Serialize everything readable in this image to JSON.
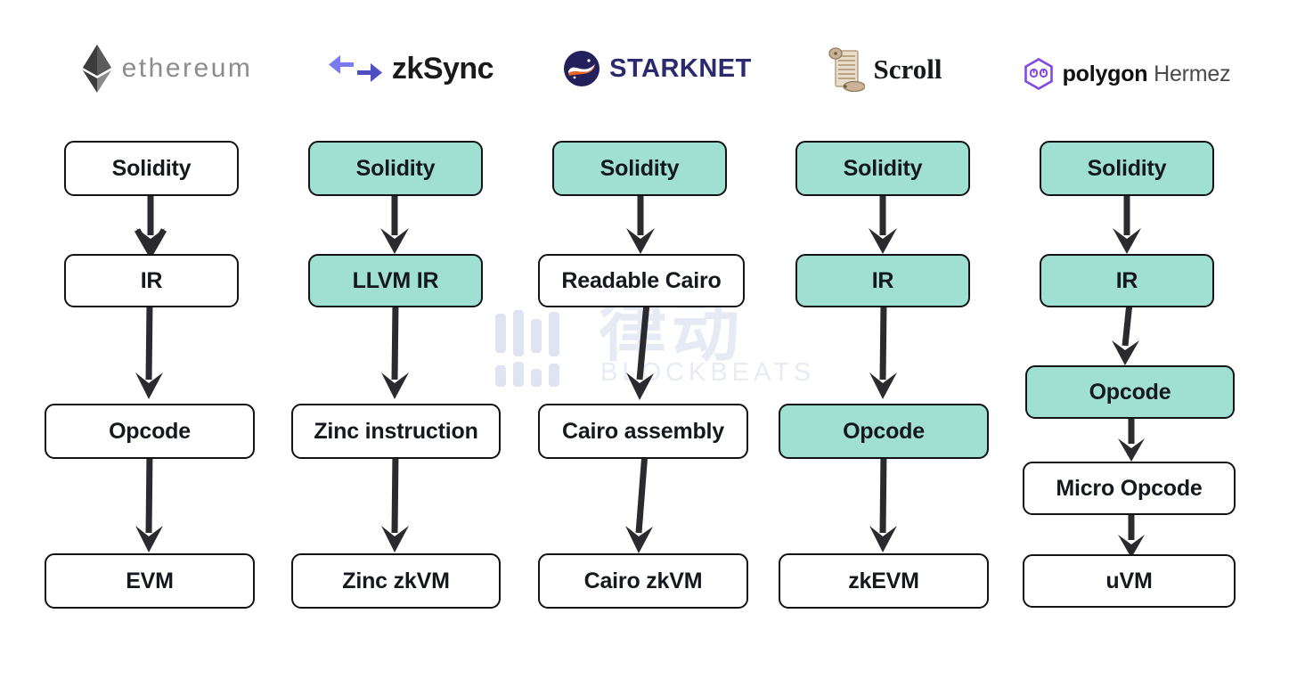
{
  "diagram": {
    "title": "zkEVM compilation pipelines",
    "accent_mint": "#9fe0d2",
    "stroke": "#111316",
    "background": "#ffffff"
  },
  "watermark": {
    "han": "律动",
    "word": "BLOCKBEATS",
    "color": "#e3e7f3"
  },
  "columns": [
    {
      "id": "ethereum",
      "logo_name": "ethereum-logo",
      "logo_text": "ethereum",
      "nodes": [
        {
          "label": "Solidity",
          "highlight": false
        },
        {
          "label": "IR",
          "highlight": false
        },
        {
          "label": "Opcode",
          "highlight": false
        },
        {
          "label": "EVM",
          "highlight": false
        }
      ]
    },
    {
      "id": "zksync",
      "logo_name": "zksync-logo",
      "logo_text": "zkSync",
      "nodes": [
        {
          "label": "Solidity",
          "highlight": true
        },
        {
          "label": "LLVM IR",
          "highlight": true
        },
        {
          "label": "Zinc instruction",
          "highlight": false
        },
        {
          "label": "Zinc zkVM",
          "highlight": false
        }
      ]
    },
    {
      "id": "starknet",
      "logo_name": "starknet-logo",
      "logo_text_1": "STARK",
      "logo_text_2": "NET",
      "nodes": [
        {
          "label": "Solidity",
          "highlight": true
        },
        {
          "label": "Readable Cairo",
          "highlight": false
        },
        {
          "label": "Cairo assembly",
          "highlight": false
        },
        {
          "label": "Cairo zkVM",
          "highlight": false
        }
      ]
    },
    {
      "id": "scroll",
      "logo_name": "scroll-logo",
      "logo_text": "Scroll",
      "nodes": [
        {
          "label": "Solidity",
          "highlight": true
        },
        {
          "label": "IR",
          "highlight": true
        },
        {
          "label": "Opcode",
          "highlight": true
        },
        {
          "label": "zkEVM",
          "highlight": false
        }
      ]
    },
    {
      "id": "polygon-hermez",
      "logo_name": "polygon-logo",
      "logo_text_1": "polygon",
      "logo_text_2": "Hermez",
      "nodes": [
        {
          "label": "Solidity",
          "highlight": true
        },
        {
          "label": "IR",
          "highlight": true
        },
        {
          "label": "Opcode",
          "highlight": true
        },
        {
          "label": "Micro Opcode",
          "highlight": false
        },
        {
          "label": "uVM",
          "highlight": false
        }
      ]
    }
  ]
}
